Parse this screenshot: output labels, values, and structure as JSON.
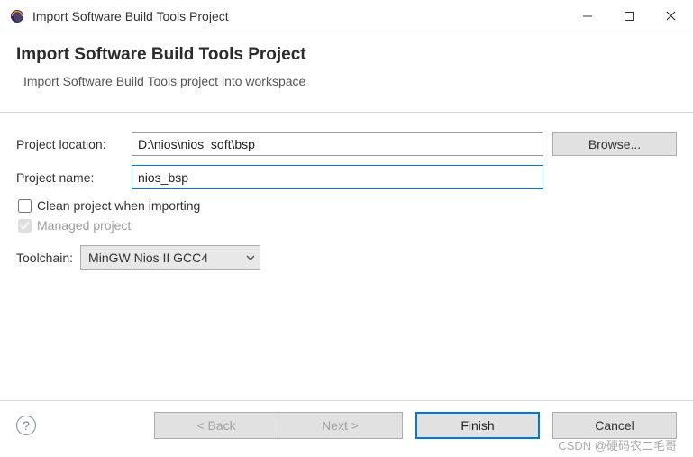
{
  "window": {
    "title": "Import Software Build Tools Project"
  },
  "banner": {
    "title": "Import Software Build Tools Project",
    "description": "Import Software Build Tools project into workspace"
  },
  "form": {
    "location_label": "Project location:",
    "location_value": "D:\\nios\\nios_soft\\bsp",
    "browse_label": "Browse...",
    "name_label": "Project name:",
    "name_value": "nios_bsp",
    "clean_label": "Clean project when importing",
    "clean_checked": false,
    "managed_label": "Managed project",
    "managed_checked": true,
    "managed_disabled": true,
    "toolchain_label": "Toolchain:",
    "toolchain_value": "MinGW Nios II GCC4"
  },
  "footer": {
    "back_label": "< Back",
    "next_label": "Next >",
    "finish_label": "Finish",
    "cancel_label": "Cancel"
  },
  "watermark": "CSDN @硬码农二毛哥"
}
